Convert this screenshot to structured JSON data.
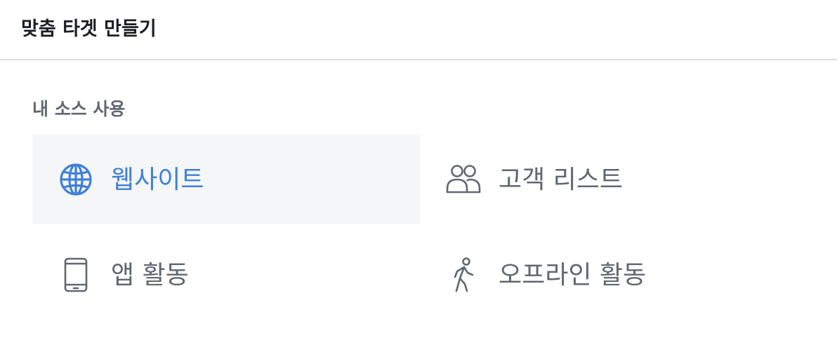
{
  "header": {
    "title": "맞춤 타겟 만들기"
  },
  "section": {
    "title": "내 소스 사용"
  },
  "colors": {
    "accent": "#4080d8",
    "text_secondary": "#606770",
    "selected_bg": "#f5f6f7",
    "divider": "#dddfe2"
  },
  "sources": [
    {
      "label": "웹사이트",
      "icon": "globe-icon",
      "selected": true
    },
    {
      "label": "고객 리스트",
      "icon": "people-icon",
      "selected": false
    },
    {
      "label": "앱 활동",
      "icon": "mobile-phone-icon",
      "selected": false
    },
    {
      "label": "오프라인 활동",
      "icon": "walking-person-icon",
      "selected": false
    }
  ]
}
